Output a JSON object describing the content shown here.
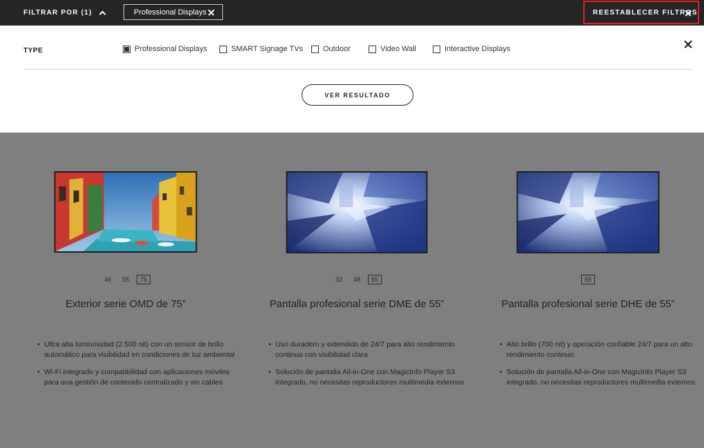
{
  "topbar": {
    "filter_label": "FILTRAR POR (1)",
    "chip_label": "Professional Displays",
    "reset_label": "REESTABLECER FILTROS"
  },
  "panel": {
    "type_label": "TYPE",
    "options": [
      {
        "label": "Professional Displays",
        "checked": true
      },
      {
        "label": "SMART Signage TVs",
        "checked": false
      },
      {
        "label": "Outdoor",
        "checked": false
      },
      {
        "label": "Video Wall",
        "checked": false
      },
      {
        "label": "Interactive Displays",
        "checked": false
      }
    ],
    "result_button": "VER RESULTADO"
  },
  "products": [
    {
      "sizes": [
        "46",
        "55",
        "75"
      ],
      "selected_size": "75",
      "name": "Exterior serie OMD de 75”",
      "features": [
        "Ultra alta luminosidad (2.500 nit) con un sensor de brillo automático para visibilidad en condiciones de luz ambiental",
        "Wi-Fi integrado y compatibilidad con aplicaciones móviles para una gestión de contenido centralizado y sin cables"
      ]
    },
    {
      "sizes": [
        "32",
        "48",
        "55"
      ],
      "selected_size": "55",
      "name": "Pantalla profesional serie DME de 55”",
      "features": [
        "Uso duradero y extendido de 24/7 para alto rendimiento continuo con visibilidad clara",
        "Solución de pantalla All-in-One con MagicInfo Player S3 integrado, no necesitas reproductores multimedia externos"
      ]
    },
    {
      "sizes": [
        "55"
      ],
      "selected_size": "55",
      "name": "Pantalla profesional serie DHE de 55”",
      "features": [
        "Alto brillo (700 nit) y operación confiable 24/7 para un alto rendimiento continuo",
        "Solución de pantalla All-in-One con MagicInfo Player S3 integrado, no necesitas reproductores multimedia externos"
      ]
    }
  ],
  "colors": {
    "topbar_bg": "#252525",
    "overlay_bg": "#7f7f7f",
    "reset_highlight": "#e41e26"
  },
  "icons": {
    "filter_toggle": "chevron-up-icon",
    "chip_remove": "close-icon",
    "reset": "close-icon",
    "panel_close": "close-icon"
  }
}
